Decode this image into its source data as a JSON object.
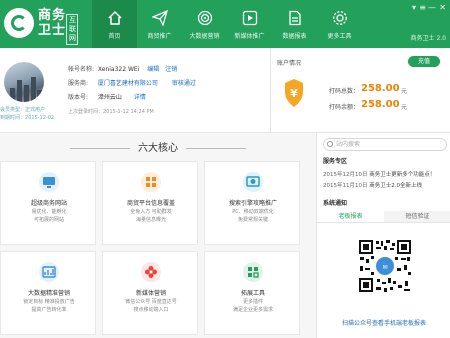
{
  "app": {
    "logo_text_line1": "商务",
    "logo_text_line2": "卫士",
    "logo_badge": "互联网",
    "version": "商务卫士 2.0"
  },
  "nav": {
    "items": [
      {
        "label": "首页",
        "icon": "home-icon"
      },
      {
        "label": "商贸推广",
        "icon": "paper-plane-icon"
      },
      {
        "label": "大数据营销",
        "icon": "target-icon"
      },
      {
        "label": "新媒体推广",
        "icon": "play-icon"
      },
      {
        "label": "数据报表",
        "icon": "document-icon"
      },
      {
        "label": "更多工具",
        "icon": "gear-icon"
      }
    ]
  },
  "profile": {
    "account_label": "帐号名称:",
    "account_value": "Xenia322 WEi",
    "edit_link": "编辑",
    "logout_link": "注销",
    "provider_label": "服务商:",
    "provider_value": "厦门喜艺建材有限公司",
    "audit_link": "审核通过",
    "version_label": "版本号:",
    "version_value": "漳州云山",
    "detail_link": "详情",
    "last_login": "上次登录时间：2015-1-12 14:24 PM",
    "member_type": "会员类型：正式用户",
    "due_label": "到期时间：",
    "due_date": "2015-12-02"
  },
  "account": {
    "title": "账户情况",
    "recharge_label": "充值",
    "row1_label": "打码总数：",
    "row1_amount": "258.00",
    "row1_unit": "元",
    "row2_label": "打码余额：",
    "row2_amount": "258.00",
    "row2_unit": "元"
  },
  "core": {
    "title": "六大核心",
    "cards": [
      {
        "title": "超级商务网站",
        "desc1": "易优化、能孵化",
        "desc2": "可拓展的网站",
        "icon": "monitor-icon",
        "color": "#3c8fd6"
      },
      {
        "title": "商贸平台信息覆盖",
        "desc1": "全免入方  可助群发",
        "desc2": "海量信息曝光",
        "icon": "grid-icon",
        "color": "#f08a24"
      },
      {
        "title": "搜索引擎攻略推广",
        "desc1": "PC、移动双端优化",
        "desc2": "免费常规关键",
        "icon": "search-globe-icon",
        "color": "#2a9cc8"
      },
      {
        "title": "大数据精准营销",
        "desc1": "锁定目标  精准投放广告",
        "desc2": "提高广告转化率",
        "icon": "chart-icon",
        "color": "#3c8fd6"
      },
      {
        "title": "新媒体营销",
        "desc1": "微信公众号  百度直达号",
        "desc2": "搜点移动端入口",
        "icon": "flower-icon",
        "color": "#e8463c"
      },
      {
        "title": "拓展工具",
        "desc1": "更多插件",
        "desc2": "满足企业更多需求",
        "icon": "puzzle-icon",
        "color": "#23a05a"
      }
    ]
  },
  "sidebar": {
    "search_placeholder": "站内搜索",
    "service_title": "服务专区",
    "news": [
      {
        "date": "2015年12月10日",
        "text": "商务卫士更新多个功能点！"
      },
      {
        "date": "2015年11月10日",
        "text": "商务卫士2.0全新上线"
      }
    ],
    "notice_title": "系统通知",
    "tabs": [
      {
        "label": "老板报表"
      },
      {
        "label": "短信验证"
      }
    ],
    "qr_caption": "扫描公众号查看手机端老板报表"
  }
}
